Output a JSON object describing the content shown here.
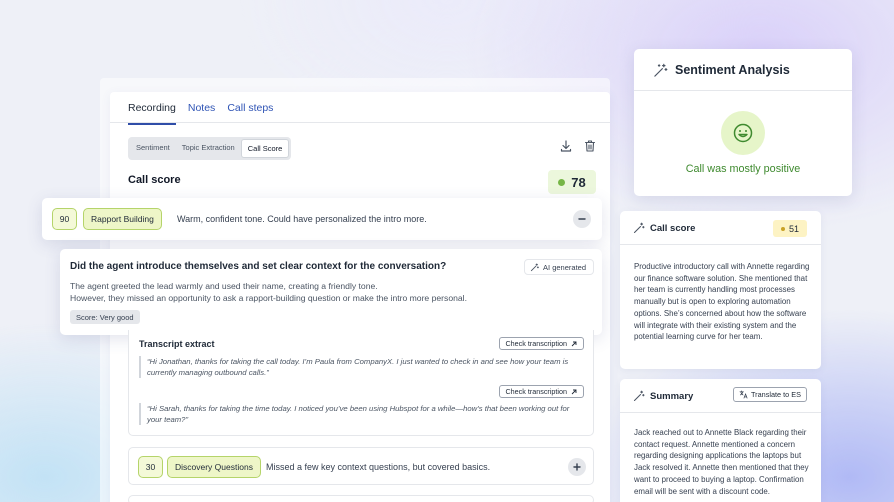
{
  "recording": {
    "tabs": [
      {
        "label": "Recording"
      },
      {
        "label": "Notes"
      },
      {
        "label": "Call steps"
      }
    ],
    "segments": [
      {
        "label": "Sentiment"
      },
      {
        "label": "Topic Extraction"
      },
      {
        "label": "Call Score"
      }
    ],
    "call_score_title": "Call score",
    "call_score_value": "78"
  },
  "rapport": {
    "score": "90",
    "category": "Rapport Building",
    "comment": "Warm, confident tone. Could have personalized the intro more."
  },
  "question": {
    "title": "Did the agent introduce themselves and set clear context for the conversation?",
    "ai_label": "AI generated",
    "line1": "The agent greeted the lead warmly and used their name, creating a friendly tone.",
    "line2": "However, they missed an opportunity to ask a rapport-building question or make the intro more personal.",
    "score_tag": "Score: Very good"
  },
  "transcript": {
    "title": "Transcript extract",
    "check_label": "Check transcription",
    "quote1": "“Hi Jonathan, thanks for taking the call today. I’m Paula from CompanyX. I just wanted to check in and see how your team is currently managing outbound calls.”",
    "quote2": "“Hi Sarah, thanks for taking the time today. I noticed you’ve been using Hubspot for a while—how’s that been working out for your team?”"
  },
  "discovery": {
    "score": "30",
    "category": "Discovery Questions",
    "comment": "Missed a few key context questions, but covered basics."
  },
  "sentiment": {
    "title": "Sentiment Analysis",
    "result": "Call was mostly positive"
  },
  "side_call_score": {
    "title": "Call score",
    "value": "51",
    "body": "Productive introductory call with Annette regarding our finance software solution. She mentioned that her team is currently handling most processes manually but is open to exploring automation options. She’s concerned about how the software will integrate with their existing system and the potential learning curve for her team."
  },
  "summary": {
    "title": "Summary",
    "translate_label": "Translate to ES",
    "body": "Jack reached out to Annette Black regarding their contact request. Annette mentioned a concern regarding designing applications the laptops but Jack resolved it. Annette then mentioned that they want to proceed to buying a laptop. Confirmation email will be sent with a discount code."
  },
  "colors": {
    "accent_blue": "#2f54b5",
    "positive_green": "#3f8a2f",
    "badge_green": "#eef6c8",
    "badge_yellow": "#fdf3c4"
  }
}
